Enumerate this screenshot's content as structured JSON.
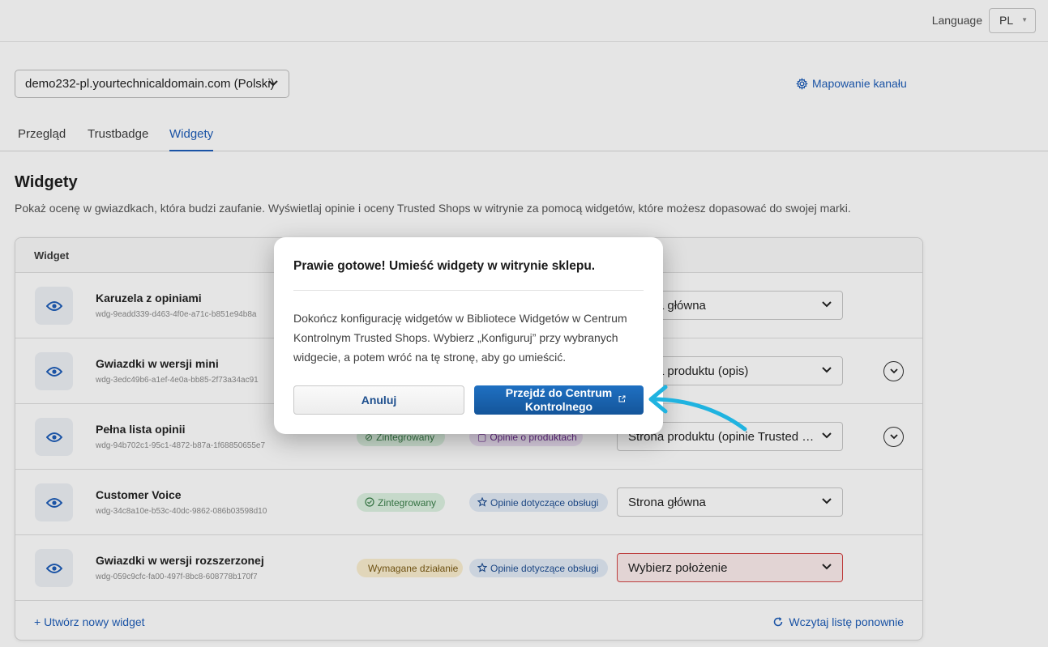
{
  "header": {
    "language_label": "Language",
    "language_value": "PL"
  },
  "shop": {
    "domain": "demo232-pl.yourtechnicaldomain.com (Polski)",
    "mapping_link": "Mapowanie kanału"
  },
  "tabs": [
    {
      "label": "Przegląd",
      "active": false
    },
    {
      "label": "Trustbadge",
      "active": false
    },
    {
      "label": "Widgety",
      "active": true
    }
  ],
  "page": {
    "title": "Widgety",
    "description": "Pokaż ocenę w gwiazdkach, która budzi zaufanie. Wyświetlaj opinie i oceny Trusted Shops w witrynie za pomocą widgetów, które możesz dopasować do swojej marki."
  },
  "table": {
    "header_widget": "Widget",
    "rows": [
      {
        "name": "Karuzela z opiniami",
        "id": "wdg-9eadd339-d463-4f0e-a71c-b851e94b8a",
        "status": "",
        "type": "",
        "location": "Strona główna",
        "expand": false
      },
      {
        "name": "Gwiazdki w wersji mini",
        "id": "wdg-3edc49b6-a1ef-4e0a-bb85-2f73a34ac91",
        "status": "",
        "type": "",
        "location": "Strona produktu (opis)",
        "expand": true
      },
      {
        "name": "Pełna lista opinii",
        "id": "wdg-94b702c1-95c1-4872-b87a-1f68850655e7",
        "status": "Zintegrowany",
        "type": "Opinie o produktach",
        "location": "Strona produktu (opinie Trusted Shops)",
        "expand": true
      },
      {
        "name": "Customer Voice",
        "id": "wdg-34c8a10e-b53c-40dc-9862-086b03598d10",
        "status": "Zintegrowany",
        "type": "Opinie dotyczące obsługi",
        "location": "Strona główna",
        "expand": false
      },
      {
        "name": "Gwiazdki w wersji rozszerzonej",
        "id": "wdg-059c9cfc-fa00-497f-8bc8-608778b170f7",
        "status": "Wymagane działanie",
        "type": "Opinie dotyczące obsługi",
        "location": "Wybierz położenie",
        "expand": false
      }
    ],
    "create_link": "+ Utwórz nowy widget",
    "reload_link": "Wczytaj listę ponownie"
  },
  "modal": {
    "title": "Prawie gotowe! Umieść widgety w witrynie sklepu.",
    "body": "Dokończ konfigurację widgetów w Bibliotece Widgetów w Centrum Kontrolnym Trusted Shops. Wybierz „Konfiguruj” przy wybranych widgecie, a potem wróć na tę stronę, aby go umieścić.",
    "cancel_label": "Anuluj",
    "primary_label_line1": "Przejdź do Centrum",
    "primary_label_line2": "Kontrolnego"
  },
  "colors": {
    "accent": "#1e5db8",
    "primary_button": "#1a63ad",
    "annotation_arrow": "#1fb3e0"
  },
  "icons": [
    "eye-icon",
    "gear-icon",
    "chevron-down-icon",
    "check-circle-icon",
    "star-icon",
    "document-icon",
    "warning-icon",
    "refresh-icon",
    "external-link-icon",
    "arrow-annotation"
  ]
}
